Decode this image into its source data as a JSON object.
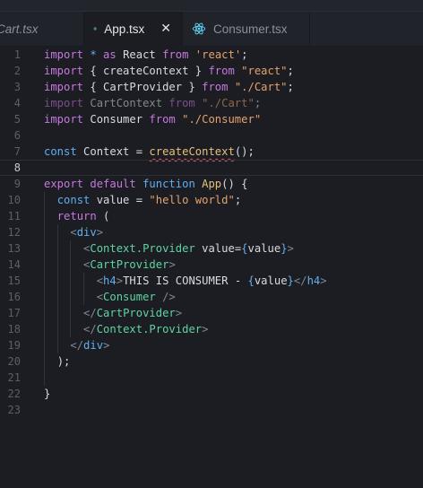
{
  "tabs": [
    {
      "label": "Cart.tsx",
      "active": false,
      "italic": true
    },
    {
      "label": "App.tsx",
      "active": true,
      "italic": false
    },
    {
      "label": "Consumer.tsx",
      "active": false,
      "italic": false
    }
  ],
  "editor": {
    "current_line": 8,
    "lines": [
      [
        {
          "t": "import",
          "c": "kw"
        },
        {
          "t": " * ",
          "c": "blue"
        },
        {
          "t": "as",
          "c": "kw"
        },
        {
          "t": " React ",
          "c": "var"
        },
        {
          "t": "from",
          "c": "kw"
        },
        {
          "t": " 'react'",
          "c": "str"
        },
        {
          "t": ";",
          "c": "var"
        }
      ],
      [
        {
          "t": "import",
          "c": "kw"
        },
        {
          "t": " { ",
          "c": "var"
        },
        {
          "t": "createContext",
          "c": "var"
        },
        {
          "t": " } ",
          "c": "var"
        },
        {
          "t": "from",
          "c": "kw"
        },
        {
          "t": " \"react\"",
          "c": "str"
        },
        {
          "t": ";",
          "c": "var"
        }
      ],
      [
        {
          "t": "import",
          "c": "kw"
        },
        {
          "t": " { ",
          "c": "var"
        },
        {
          "t": "CartProvider",
          "c": "var"
        },
        {
          "t": " } ",
          "c": "var"
        },
        {
          "t": "from",
          "c": "kw"
        },
        {
          "t": " \"./Cart\"",
          "c": "str"
        },
        {
          "t": ";",
          "c": "var"
        }
      ],
      [
        {
          "t": "import",
          "c": "kw dim"
        },
        {
          "t": " CartContext ",
          "c": "var dim"
        },
        {
          "t": "from",
          "c": "kw dim"
        },
        {
          "t": " \"./Cart\"",
          "c": "str dim"
        },
        {
          "t": ";",
          "c": "var dim"
        }
      ],
      [
        {
          "t": "import",
          "c": "kw"
        },
        {
          "t": " Consumer ",
          "c": "var"
        },
        {
          "t": "from",
          "c": "kw"
        },
        {
          "t": " \"./Consumer\"",
          "c": "str"
        }
      ],
      [],
      [
        {
          "t": "const",
          "c": "blue"
        },
        {
          "t": " Context ",
          "c": "var"
        },
        {
          "t": "=",
          "c": "var"
        },
        {
          "t": " ",
          "c": "var"
        },
        {
          "t": "createContext",
          "c": "fn squiggle"
        },
        {
          "t": "();",
          "c": "var"
        }
      ],
      [],
      [
        {
          "t": "export",
          "c": "kw"
        },
        {
          "t": " default ",
          "c": "kw"
        },
        {
          "t": "function",
          "c": "blue"
        },
        {
          "t": " App",
          "c": "fn"
        },
        {
          "t": "() {",
          "c": "var"
        }
      ],
      [
        {
          "t": "  ",
          "c": "var"
        },
        {
          "t": "const",
          "c": "blue"
        },
        {
          "t": " value ",
          "c": "var"
        },
        {
          "t": "=",
          "c": "var"
        },
        {
          "t": " \"hello world\"",
          "c": "str"
        },
        {
          "t": ";",
          "c": "var"
        }
      ],
      [
        {
          "t": "  ",
          "c": "var"
        },
        {
          "t": "return",
          "c": "kw"
        },
        {
          "t": " (",
          "c": "var"
        }
      ],
      [
        {
          "t": "    ",
          "c": "var"
        },
        {
          "t": "<",
          "c": "punc"
        },
        {
          "t": "div",
          "c": "tagblue"
        },
        {
          "t": ">",
          "c": "punc"
        }
      ],
      [
        {
          "t": "      ",
          "c": "var"
        },
        {
          "t": "<",
          "c": "punc"
        },
        {
          "t": "Context.Provider",
          "c": "tag"
        },
        {
          "t": " value",
          "c": "attr"
        },
        {
          "t": "=",
          "c": "var"
        },
        {
          "t": "{",
          "c": "blue"
        },
        {
          "t": "value",
          "c": "var"
        },
        {
          "t": "}",
          "c": "blue"
        },
        {
          "t": ">",
          "c": "punc"
        }
      ],
      [
        {
          "t": "      ",
          "c": "var"
        },
        {
          "t": "<",
          "c": "punc"
        },
        {
          "t": "CartProvider",
          "c": "tag"
        },
        {
          "t": ">",
          "c": "punc"
        }
      ],
      [
        {
          "t": "        ",
          "c": "var"
        },
        {
          "t": "<",
          "c": "punc"
        },
        {
          "t": "h4",
          "c": "tagblue"
        },
        {
          "t": ">",
          "c": "punc"
        },
        {
          "t": "THIS IS CONSUMER - ",
          "c": "var"
        },
        {
          "t": "{",
          "c": "blue"
        },
        {
          "t": "value",
          "c": "var"
        },
        {
          "t": "}",
          "c": "blue"
        },
        {
          "t": "</",
          "c": "punc"
        },
        {
          "t": "h4",
          "c": "tagblue"
        },
        {
          "t": ">",
          "c": "punc"
        }
      ],
      [
        {
          "t": "        ",
          "c": "var"
        },
        {
          "t": "<",
          "c": "punc"
        },
        {
          "t": "Consumer",
          "c": "tag"
        },
        {
          "t": " />",
          "c": "punc"
        }
      ],
      [
        {
          "t": "      ",
          "c": "var"
        },
        {
          "t": "</",
          "c": "punc"
        },
        {
          "t": "CartProvider",
          "c": "tag"
        },
        {
          "t": ">",
          "c": "punc"
        }
      ],
      [
        {
          "t": "      ",
          "c": "var"
        },
        {
          "t": "</",
          "c": "punc"
        },
        {
          "t": "Context.Provider",
          "c": "tag"
        },
        {
          "t": ">",
          "c": "punc"
        }
      ],
      [
        {
          "t": "    ",
          "c": "var"
        },
        {
          "t": "</",
          "c": "punc"
        },
        {
          "t": "div",
          "c": "tagblue"
        },
        {
          "t": ">",
          "c": "punc"
        }
      ],
      [
        {
          "t": "  ",
          "c": "var"
        },
        {
          "t": ");",
          "c": "var"
        }
      ],
      [],
      [
        {
          "t": "}",
          "c": "var"
        }
      ],
      []
    ]
  },
  "colors": {
    "background": "#1b1d23",
    "tabbar": "#202329",
    "keyword": "#c678dd",
    "string": "#e5a26b",
    "jsx_tag": "#5fd4a0",
    "function": "#e5c07b",
    "error_squiggle": "#e05561",
    "react_icon": "#61dafb"
  },
  "icons": {
    "tab_file": "react-icon",
    "tab_close": "close-icon"
  }
}
